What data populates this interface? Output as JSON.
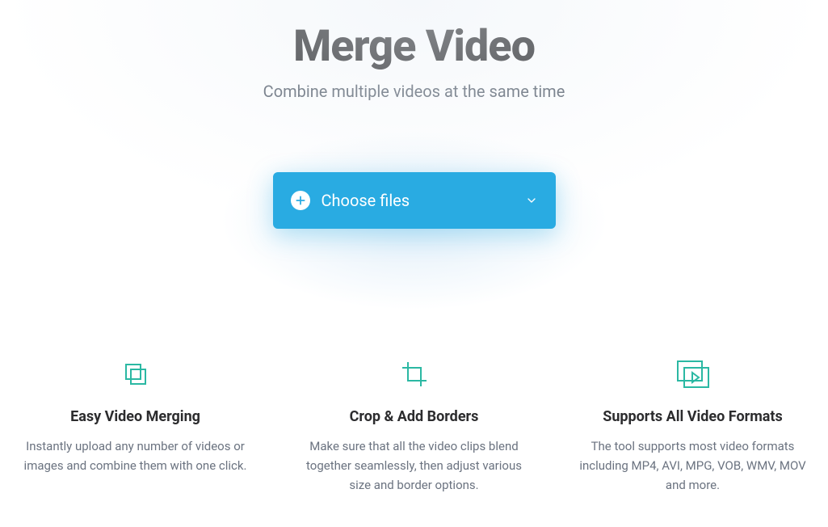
{
  "hero": {
    "title": "Merge Video",
    "subtitle": "Combine multiple videos at the same time"
  },
  "choose": {
    "label": "Choose files"
  },
  "features": [
    {
      "title": "Easy Video Merging",
      "desc": "Instantly upload any number of videos or images and combine them with one click."
    },
    {
      "title": "Crop & Add Borders",
      "desc": "Make sure that all the video clips blend together seamlessly, then adjust various size and border options."
    },
    {
      "title": "Supports All Video Formats",
      "desc": "The tool supports most video formats including MP4, AVI, MPG, VOB, WMV, MOV and more."
    }
  ]
}
